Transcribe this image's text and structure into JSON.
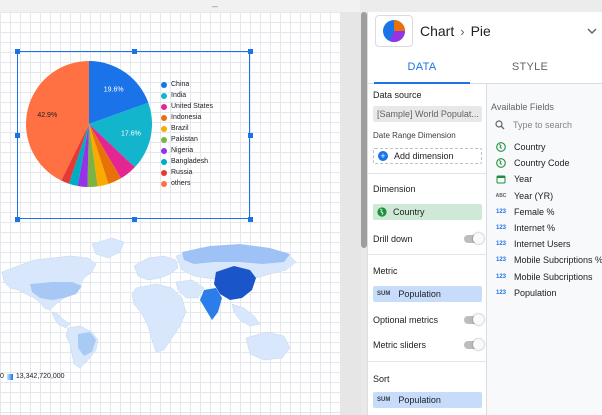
{
  "chart_data": [
    {
      "type": "pie",
      "labels": [
        "China",
        "India",
        "United States",
        "Indonesia",
        "Brazil",
        "Pakistan",
        "Nigeria",
        "Bangladesh",
        "Russia",
        "others"
      ],
      "values": [
        19.6,
        17.6,
        4.5,
        3.5,
        2.8,
        2.6,
        2.5,
        2.3,
        2.1,
        42.9
      ],
      "data_labels": [
        "19.6%",
        "17.6%",
        "42.9%"
      ],
      "colors": [
        "#1a73e8",
        "#12b5cb",
        "#e52592",
        "#e8710a",
        "#f9ab00",
        "#7cb342",
        "#9334e6",
        "#00acc1",
        "#e53935",
        "#ff7043"
      ],
      "legend": "right"
    },
    {
      "type": "heatmap",
      "legend_min": "0",
      "legend_max": "13,342,720,000"
    }
  ],
  "panel": {
    "breadcrumb": {
      "parent": "Chart",
      "current": "Pie"
    },
    "tabs": [
      {
        "label": "DATA",
        "active": true
      },
      {
        "label": "STYLE",
        "active": false
      }
    ],
    "data_source": {
      "label": "Data source",
      "value": "[Sample] World Populat..."
    },
    "date_range": {
      "label": "Date Range Dimension",
      "add_label": "Add dimension"
    },
    "dimension": {
      "label": "Dimension",
      "value": "Country"
    },
    "drill_down": {
      "label": "Drill down",
      "on": false
    },
    "metric": {
      "label": "Metric",
      "agg": "SUM",
      "value": "Population"
    },
    "optional_metrics": {
      "label": "Optional metrics",
      "on": false
    },
    "metric_sliders": {
      "label": "Metric sliders",
      "on": false
    },
    "sort": {
      "label": "Sort",
      "agg": "SUM",
      "value": "Population"
    }
  },
  "available_fields": {
    "title": "Available Fields",
    "search_placeholder": "Type to search",
    "fields": [
      {
        "name": "Country",
        "type": "geo"
      },
      {
        "name": "Country Code",
        "type": "geo"
      },
      {
        "name": "Year",
        "type": "date"
      },
      {
        "name": "Year (YR)",
        "type": "text"
      },
      {
        "name": "Female %",
        "type": "number"
      },
      {
        "name": "Internet %",
        "type": "number"
      },
      {
        "name": "Internet Users",
        "type": "number"
      },
      {
        "name": "Mobile Subcriptions %",
        "type": "number"
      },
      {
        "name": "Mobile Subcriptions",
        "type": "number"
      },
      {
        "name": "Population",
        "type": "number"
      }
    ]
  },
  "type_tags": {
    "number": "123",
    "text": "ABC"
  }
}
